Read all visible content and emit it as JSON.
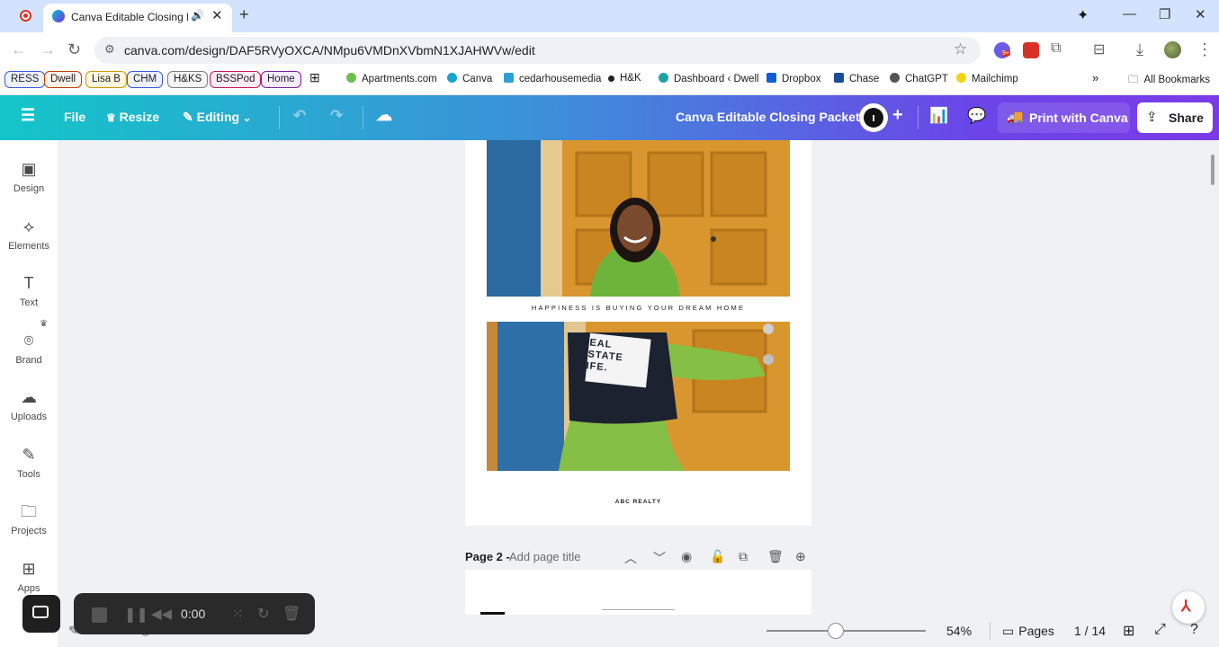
{
  "browser": {
    "tab_title": "Canva Editable Closing Packet",
    "url": "canva.com/design/DAF5RVyOXCA/NMpu6VMDnXVbmN1XJAHWVw/edit",
    "ext_badge": "9+"
  },
  "bookmarks": {
    "chips": [
      {
        "label": "RESS",
        "color": "#3b5bdb"
      },
      {
        "label": "Dwell",
        "color": "#c2410c"
      },
      {
        "label": "Lisa B",
        "color": "#c99a06"
      },
      {
        "label": "CHM",
        "color": "#3b5bdb"
      },
      {
        "label": "H&KS",
        "color": "#7c7c7c"
      },
      {
        "label": "BSSPod",
        "color": "#c2185b"
      },
      {
        "label": "Home",
        "color": "#7b1fa2"
      }
    ],
    "links": [
      "Apartments.com",
      "Canva",
      "cedarhousemedia",
      "H&K",
      "Dashboard ‹ Dwell",
      "Dropbox",
      "Chase",
      "ChatGPT",
      "Mailchimp"
    ],
    "all_bookmarks": "All Bookmarks"
  },
  "header": {
    "file": "File",
    "resize": "Resize",
    "editing": "Editing",
    "design_title": "Canva Editable Closing Packet",
    "print": "Print with Canva",
    "share": "Share",
    "gradient_start": "#14c5c9",
    "gradient_end": "#7a3ae8"
  },
  "rail": [
    "Design",
    "Elements",
    "Text",
    "Brand",
    "Uploads",
    "Tools",
    "Projects",
    "Apps"
  ],
  "page1": {
    "tagline": "HAPPINESS IS BUYING YOUR DREAM HOME",
    "bag_text": "REAL ESTATE LIFE.",
    "footer": "ABC REALTY"
  },
  "page2": {
    "label": "Page 2 -",
    "title_placeholder": "Add page title"
  },
  "bottom": {
    "zoom": "54%",
    "zoom_fraction": 0.54,
    "pages_label": "Pages",
    "page_counter": "1 / 14",
    "notes": "Notes",
    "timer_label": "Timer"
  },
  "recorder": {
    "time": "0:00"
  }
}
